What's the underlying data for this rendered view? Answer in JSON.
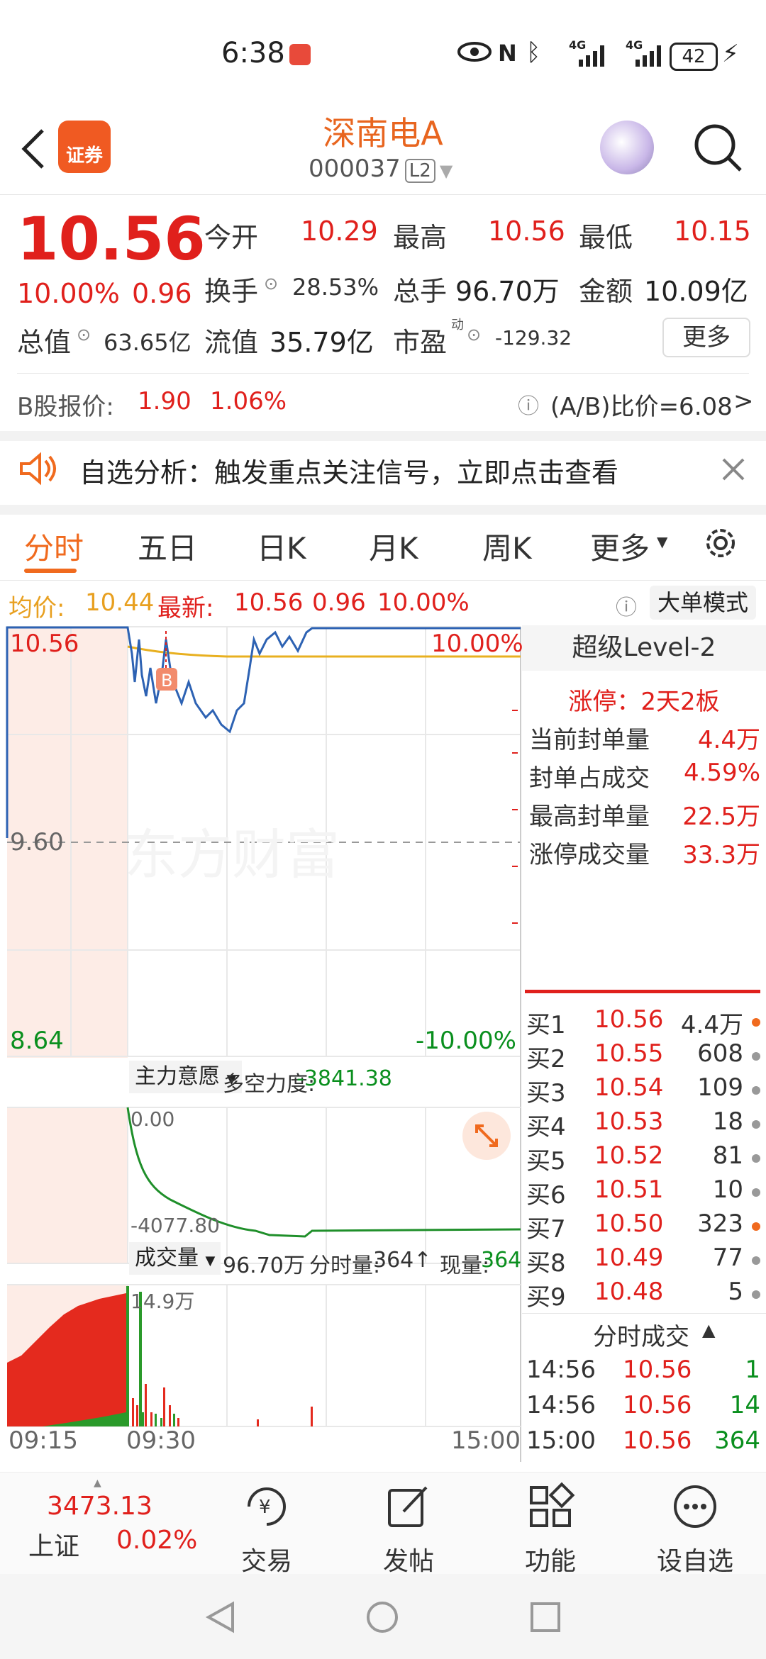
{
  "status_bar": {
    "time": "6:38",
    "battery": "42",
    "signal1": "4G",
    "signal2": "4G"
  },
  "header": {
    "title": "深南电A",
    "code": "000037",
    "level_tag": "L2",
    "logo_text": "证券"
  },
  "quote": {
    "price": "10.56",
    "pct": "10.00%",
    "change": "0.96",
    "open_label": "今开",
    "open": "10.29",
    "high_label": "最高",
    "high": "10.56",
    "low_label": "最低",
    "low": "10.15",
    "turnover_label": "换手",
    "turnover": "28.53%",
    "volume_label": "总手",
    "volume": "96.70万",
    "amount_label": "金额",
    "amount": "10.09亿",
    "mktcap_label": "总值",
    "mktcap": "63.65亿",
    "float_label": "流值",
    "float": "35.79亿",
    "pe_label": "市盈",
    "pe_sup": "动",
    "pe": "-129.32",
    "more_button": "更多"
  },
  "bshare": {
    "label": "B股报价:",
    "price": "1.90",
    "pct": "1.06%",
    "ratio_label": "(A/B)比价=6.08",
    "arrow": ">"
  },
  "notice": {
    "text": "自选分析：触发重点关注信号，立即点击查看"
  },
  "tabs": [
    "分时",
    "五日",
    "日K",
    "月K",
    "周K",
    "更多"
  ],
  "info_line": {
    "avg_label": "均价:",
    "avg": "10.44",
    "latest_label": "最新:",
    "latest": "10.56",
    "chg": "0.96",
    "pct": "10.00%",
    "mode_button": "大单模式"
  },
  "chart": {
    "price_top": "10.56",
    "price_mid": "9.60",
    "price_bottom": "8.64",
    "pct_top": "10.00%",
    "pct_bottom": "-10.00%",
    "watermark": "东方财富",
    "b_marker": "B",
    "indicator_label": "主力意愿",
    "indicator_name": "多空力度:",
    "indicator_value": "-3841.38",
    "ind_top": "0.00",
    "ind_bottom": "-4077.80",
    "vol_label": "成交量",
    "vol_total": "96.70万",
    "vol_min_label": "分时量:",
    "vol_min": "364↑",
    "vol_now_label": "现量:",
    "vol_now": "364",
    "vol_max": "14.9万",
    "time_start": "09:15",
    "time_mid": "09:30",
    "time_end": "15:00"
  },
  "chart_data": {
    "type": "line",
    "x": [
      "09:15",
      "09:30",
      "09:35",
      "09:40",
      "09:45",
      "09:50",
      "10:00",
      "10:10",
      "10:20",
      "10:30",
      "11:00",
      "13:00",
      "14:00",
      "15:00"
    ],
    "series": [
      {
        "name": "最新",
        "values": [
          10.56,
          10.56,
          10.3,
          10.45,
          10.35,
          10.4,
          10.3,
          10.25,
          10.4,
          10.5,
          10.56,
          10.56,
          10.56,
          10.56
        ]
      },
      {
        "name": "均价",
        "values": [
          null,
          10.5,
          10.47,
          10.46,
          10.45,
          10.45,
          10.44,
          10.44,
          10.44,
          10.44,
          10.44,
          10.44,
          10.44,
          10.44
        ]
      }
    ],
    "ylim": [
      8.64,
      10.56
    ]
  },
  "level2": {
    "title": "超级Level-2",
    "limit_label": "涨停：2天2板",
    "summary": [
      {
        "k": "当前封单量",
        "v": "4.4万"
      },
      {
        "k": "封单占成交",
        "v": "4.59%"
      },
      {
        "k": "最高封单量",
        "v": "22.5万"
      },
      {
        "k": "涨停成交量",
        "v": "33.3万"
      }
    ],
    "bids": [
      {
        "l": "买1",
        "p": "10.56",
        "v": "4.4万",
        "orange": true
      },
      {
        "l": "买2",
        "p": "10.55",
        "v": "608",
        "orange": false
      },
      {
        "l": "买3",
        "p": "10.54",
        "v": "109",
        "orange": false
      },
      {
        "l": "买4",
        "p": "10.53",
        "v": "18",
        "orange": false
      },
      {
        "l": "买5",
        "p": "10.52",
        "v": "81",
        "orange": false
      },
      {
        "l": "买6",
        "p": "10.51",
        "v": "10",
        "orange": false
      },
      {
        "l": "买7",
        "p": "10.50",
        "v": "323",
        "orange": true
      },
      {
        "l": "买8",
        "p": "10.49",
        "v": "77",
        "orange": false
      },
      {
        "l": "买9",
        "p": "10.48",
        "v": "5",
        "orange": false
      }
    ],
    "ticks_title": "分时成交",
    "ticks": [
      {
        "t": "14:56",
        "p": "10.56",
        "v": "1"
      },
      {
        "t": "14:56",
        "p": "10.56",
        "v": "14"
      },
      {
        "t": "15:00",
        "p": "10.56",
        "v": "364"
      }
    ]
  },
  "bottom_nav": {
    "index_value": "3473.13",
    "index_name": "上证",
    "index_pct": "0.02%",
    "items": [
      "交易",
      "发帖",
      "功能",
      "设自选"
    ]
  }
}
